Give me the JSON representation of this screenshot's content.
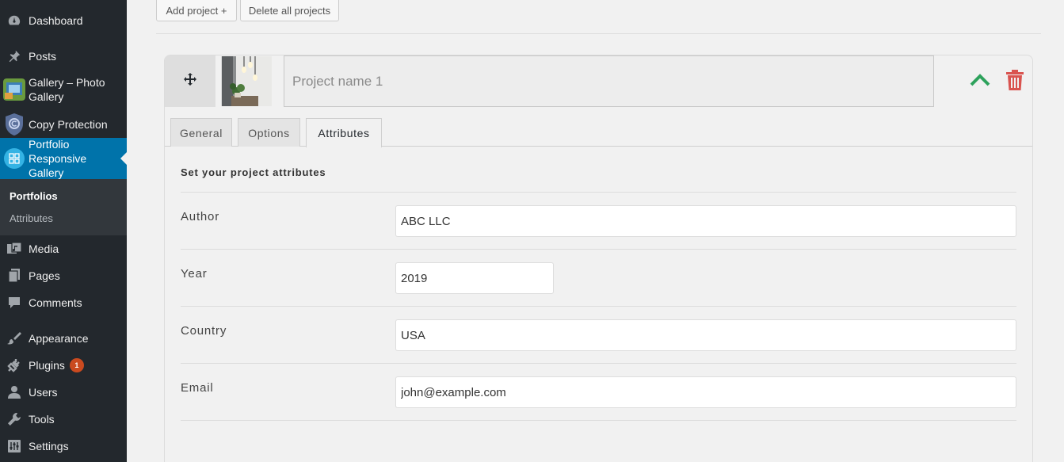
{
  "sidebar": {
    "items": [
      {
        "label": "Dashboard",
        "icon": "dashboard-icon"
      },
      {
        "label": "Posts",
        "icon": "pin-icon"
      },
      {
        "label": "Gallery – Photo Gallery",
        "icon": "gallery-plugin-icon"
      },
      {
        "label": "Copy Protection",
        "icon": "shield-icon"
      },
      {
        "label": "Portfolio Responsive Gallery",
        "icon": "portfolio-grid-icon"
      },
      {
        "label": "Media",
        "icon": "media-icon"
      },
      {
        "label": "Pages",
        "icon": "pages-icon"
      },
      {
        "label": "Comments",
        "icon": "comment-icon"
      },
      {
        "label": "Appearance",
        "icon": "paintbrush-icon"
      },
      {
        "label": "Plugins",
        "icon": "plug-icon",
        "badge": "1"
      },
      {
        "label": "Users",
        "icon": "user-icon"
      },
      {
        "label": "Tools",
        "icon": "wrench-icon"
      },
      {
        "label": "Settings",
        "icon": "sliders-icon"
      }
    ],
    "submenu": [
      {
        "label": "Portfolios",
        "current": true
      },
      {
        "label": "Attributes",
        "current": false
      }
    ],
    "colors": {
      "bg": "#23282d",
      "active": "#0073aa",
      "submenu_bg": "#32373c",
      "badge": "#ca4a1f"
    }
  },
  "toolbar": {
    "add_project": "Add project +",
    "delete_all": "Delete all projects"
  },
  "project": {
    "name_placeholder": "Project name 1",
    "tabs": [
      "General",
      "Options",
      "Attributes"
    ],
    "active_tab": "Attributes",
    "heading": "Set your project attributes",
    "attributes": [
      {
        "label": "Author",
        "value": "ABC LLC"
      },
      {
        "label": "Year",
        "value": "2019"
      },
      {
        "label": "Country",
        "value": "USA"
      },
      {
        "label": "Email",
        "value": "john@example.com"
      }
    ],
    "colors": {
      "collapse": "#2ea25c",
      "delete": "#d9534f"
    }
  }
}
